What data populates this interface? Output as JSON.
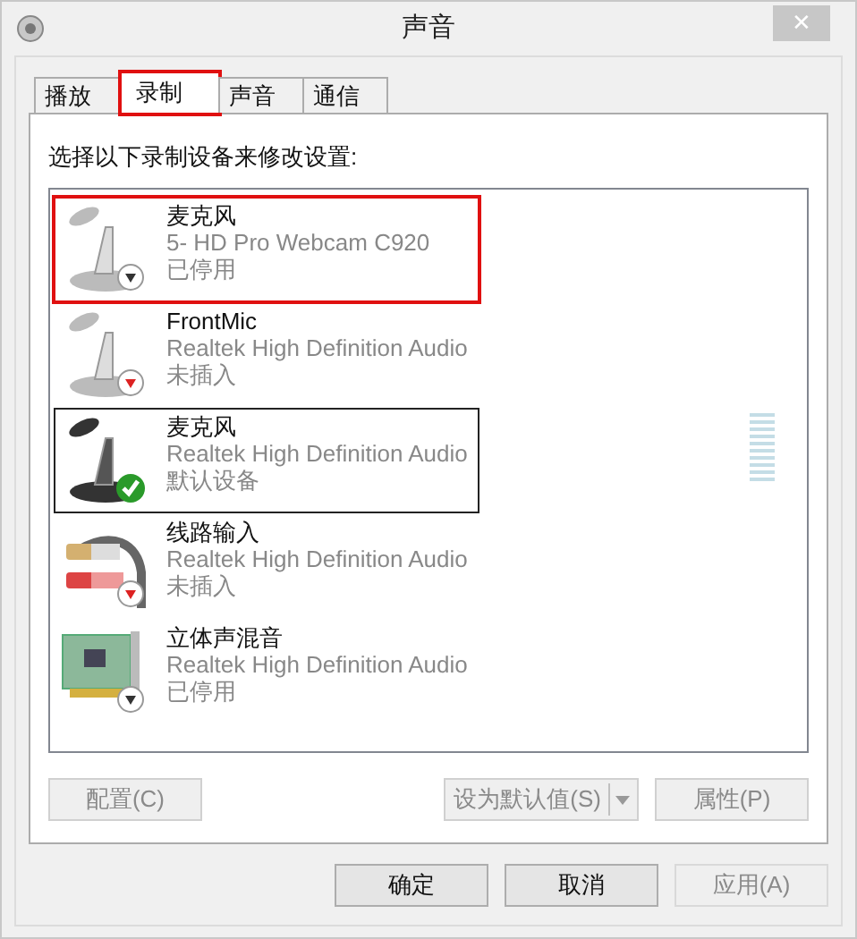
{
  "window": {
    "title": "声音",
    "close": "✕"
  },
  "tabs": [
    {
      "label": "播放",
      "selected": false,
      "highlighted": false
    },
    {
      "label": "录制",
      "selected": true,
      "highlighted": true
    },
    {
      "label": "声音",
      "selected": false,
      "highlighted": false
    },
    {
      "label": "通信",
      "selected": false,
      "highlighted": false
    }
  ],
  "instruction": "选择以下录制设备来修改设置:",
  "devices": [
    {
      "kind": "mic",
      "name": "麦克风",
      "driver": "5- HD Pro Webcam C920",
      "status": "已停用",
      "is_default": false,
      "unplugged": false,
      "selected": false,
      "highlighted": true
    },
    {
      "kind": "mic",
      "name": "FrontMic",
      "driver": "Realtek High Definition Audio",
      "status": "未插入",
      "is_default": false,
      "unplugged": true,
      "selected": false,
      "highlighted": false
    },
    {
      "kind": "mic",
      "name": "麦克风",
      "driver": "Realtek High Definition Audio",
      "status": "默认设备",
      "is_default": true,
      "unplugged": false,
      "selected": true,
      "highlighted": false
    },
    {
      "kind": "line",
      "name": "线路输入",
      "driver": "Realtek High Definition Audio",
      "status": "未插入",
      "is_default": false,
      "unplugged": true,
      "selected": false,
      "highlighted": false
    },
    {
      "kind": "card",
      "name": "立体声混音",
      "driver": "Realtek High Definition Audio",
      "status": "已停用",
      "is_default": false,
      "unplugged": false,
      "selected": false,
      "highlighted": false
    }
  ],
  "panel_buttons": {
    "configure": "配置(C)",
    "set_default": "设为默认值(S)",
    "properties": "属性(P)"
  },
  "dialog_buttons": [
    {
      "label": "确定",
      "disabled": false
    },
    {
      "label": "取消",
      "disabled": false
    },
    {
      "label": "应用(A)",
      "disabled": true
    }
  ]
}
